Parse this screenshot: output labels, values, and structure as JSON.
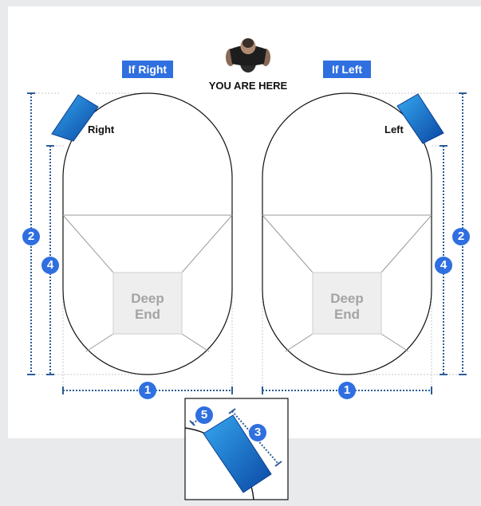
{
  "labels": {
    "if_right": "If Right",
    "if_left": "If Left",
    "you_are_here": "YOU ARE HERE",
    "right": "Right",
    "left": "Left",
    "deep_end_line1": "Deep",
    "deep_end_line2": "End"
  },
  "badges": {
    "one": "1",
    "two": "2",
    "three": "3",
    "four": "4",
    "five": "5"
  },
  "colors": {
    "accent": "#2f6fe0",
    "dimension_dots": "#2c5d96",
    "step_blue_light": "#2f9fe8",
    "step_blue_dark": "#0b4aa6",
    "deep_end_fill": "#eeeeee",
    "deep_end_text": "#a4a4a4"
  },
  "icons": {
    "person": "person-standing-topdown-icon"
  }
}
